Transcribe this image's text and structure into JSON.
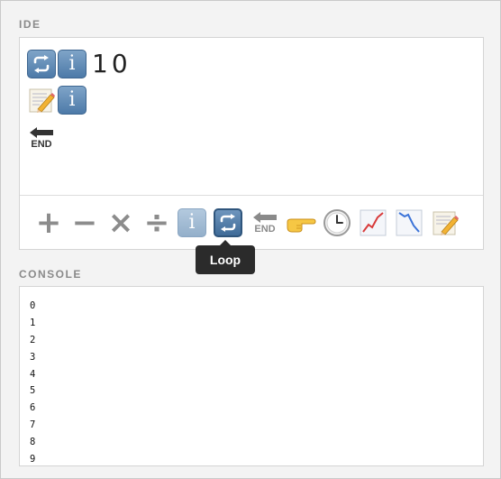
{
  "ide": {
    "label": "IDE",
    "code": {
      "line1_number": "10"
    },
    "end_label": "END"
  },
  "palette": {
    "items": [
      {
        "name": "add",
        "symbol": "+"
      },
      {
        "name": "subtract",
        "symbol": "−"
      },
      {
        "name": "multiply",
        "symbol": "×"
      },
      {
        "name": "divide",
        "symbol": "÷"
      },
      {
        "name": "info",
        "icon": "info-icon"
      },
      {
        "name": "loop",
        "icon": "loop-icon"
      },
      {
        "name": "end",
        "icon": "end-arrow-icon"
      },
      {
        "name": "pointer",
        "icon": "pointing-hand-icon"
      },
      {
        "name": "clock",
        "icon": "clock-icon"
      },
      {
        "name": "chart-up",
        "icon": "chart-up-icon"
      },
      {
        "name": "chart-down",
        "icon": "chart-down-icon"
      },
      {
        "name": "memo",
        "icon": "memo-icon"
      }
    ],
    "end_label": "END",
    "tooltip": "Loop"
  },
  "console": {
    "label": "CONSOLE",
    "lines": [
      "0",
      "1",
      "2",
      "3",
      "4",
      "5",
      "6",
      "7",
      "8",
      "9"
    ]
  },
  "colors": {
    "tile_blue": "#5b86b2",
    "tooltip_bg": "#2b2b2b",
    "operator_gray": "#8c8c8c"
  }
}
